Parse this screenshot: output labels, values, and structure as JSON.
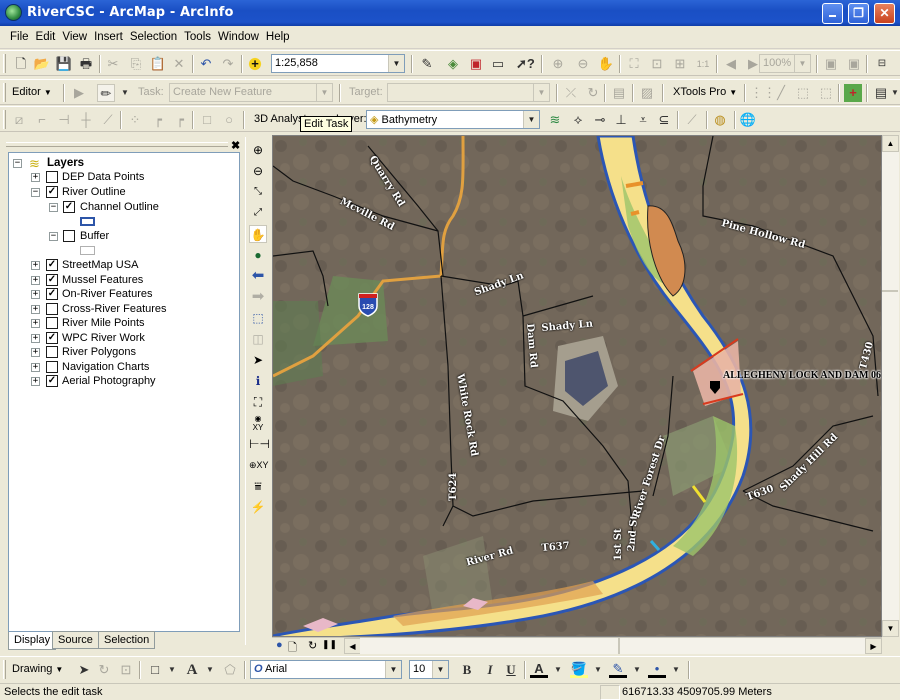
{
  "window": {
    "title": "RiverCSC - ArcMap - ArcInfo",
    "controls": {
      "minimize": "_",
      "restore": "❐",
      "close": "✕"
    }
  },
  "menu": [
    "File",
    "Edit",
    "View",
    "Insert",
    "Selection",
    "Tools",
    "Window",
    "Help"
  ],
  "standard_toolbar": {
    "scale_value": "1:25,858",
    "zoom_percent": "100%",
    "icons": [
      "new-document-icon",
      "open-folder-icon",
      "save-icon",
      "print-icon",
      "cut-icon",
      "copy-icon",
      "paste-icon",
      "delete-icon",
      "undo-icon",
      "redo-icon",
      "add-data-icon",
      "editor-toolbar-icon",
      "arctoolbox-icon",
      "command-line-icon",
      "whats-this-icon",
      "zoom-in-fixed-icon",
      "zoom-out-fixed-icon",
      "pan-layout-icon",
      "full-extent-icon",
      "zoom-layout-icon",
      "zoom-whole-page-icon",
      "zoom-100-icon",
      "back-extent-icon",
      "forward-extent-icon",
      "toggle-draft-icon",
      "focus-data-frame-icon",
      "change-layout-icon"
    ]
  },
  "editor_toolbar": {
    "editor_label": "Editor",
    "task_label": "Task:",
    "task_value": "Create New Feature",
    "target_label": "Target:",
    "target_value": "",
    "xtools_label": "XTools Pro"
  },
  "analyst_toolbar": {
    "label": "3D Analyst",
    "layer_label": "Layer:",
    "layer_value": "Bathymetry"
  },
  "tooltip": "Edit Task",
  "toc": {
    "root_label": "Layers",
    "layers": [
      {
        "name": "DEP Data Points",
        "checked": false,
        "expanded": false
      },
      {
        "name": "River Outline",
        "checked": true,
        "expanded": true,
        "children": [
          {
            "name": "Channel Outline",
            "checked": true,
            "expanded": true,
            "symbol_color": "#2d55a8"
          },
          {
            "name": "Buffer",
            "checked": false,
            "expanded": true,
            "symbol_color": "#b0b0b0"
          }
        ]
      },
      {
        "name": "StreetMap USA",
        "checked": true,
        "expanded": false
      },
      {
        "name": "Mussel Features",
        "checked": true,
        "expanded": false
      },
      {
        "name": "On-River Features",
        "checked": true,
        "expanded": false
      },
      {
        "name": "Cross-River Features",
        "checked": false,
        "expanded": false
      },
      {
        "name": "River Mile Points",
        "checked": false,
        "expanded": false
      },
      {
        "name": "WPC River Work",
        "checked": true,
        "expanded": false
      },
      {
        "name": "River Polygons",
        "checked": false,
        "expanded": false
      },
      {
        "name": "Navigation Charts",
        "checked": false,
        "expanded": false
      },
      {
        "name": "Aerial Photography",
        "checked": true,
        "expanded": false
      }
    ],
    "tabs": [
      "Display",
      "Source",
      "Selection"
    ],
    "active_tab": "Display"
  },
  "tools": [
    "zoom-in-icon",
    "zoom-out-icon",
    "fixed-zoom-in-icon",
    "fixed-zoom-out-icon",
    "pan-icon",
    "full-extent-globe-icon",
    "previous-extent-icon",
    "next-extent-icon",
    "select-features-icon",
    "clear-selection-icon",
    "select-elements-icon",
    "identify-icon",
    "find-icon",
    "go-to-xy-icon",
    "measure-icon",
    "add-xy-icon",
    "swipe-icon",
    "hyperlink-icon"
  ],
  "map": {
    "road_labels": [
      "Quarry Rd",
      "Mcville Rd",
      "Shady Ln",
      "Shady Ln",
      "Pine Hollow Rd",
      "White Rock Rd",
      "Dam Rd",
      "T624",
      "River Rd",
      "T637",
      "1st St",
      "2nd St",
      "River Forest Dr",
      "Shady Hill Rd",
      "T630",
      "T430",
      "1st"
    ],
    "highway_shield": "128",
    "dam_label": "ALLEGHENY LOCK AND DAM 06",
    "colors": {
      "river_outline": "#2b56b5",
      "shallow": "#f5e08a",
      "mid": "#9cc46a",
      "deep_green": "#6ea85a",
      "island": "#d18a50",
      "highway": "#e0a040",
      "dam_zone": "#e8b4a4",
      "dam_line": "#d83a1e"
    }
  },
  "drawing_toolbar": {
    "label": "Drawing",
    "font_name": "Arial",
    "font_size": "10",
    "bold": "B",
    "italic": "I",
    "underline": "U"
  },
  "status": {
    "message": "Selects the edit task",
    "coordinates": "616713.33  4509705.99 Meters"
  }
}
